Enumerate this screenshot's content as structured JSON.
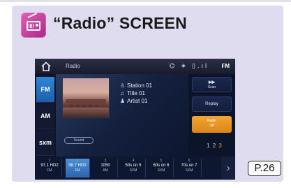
{
  "header": {
    "icon": "radio-icon",
    "title": "“Radio” SCREEN"
  },
  "screen": {
    "status_bar": {
      "home_icon": "home-icon",
      "title": "Radio",
      "icons_text": "⌬ ∗ ▯.ıl",
      "band": "FM"
    },
    "band_buttons": [
      {
        "label": "FM",
        "active": true
      },
      {
        "label": "AM",
        "active": false
      },
      {
        "label": "sxm",
        "active": false
      }
    ],
    "now_playing": {
      "station": "Station 01",
      "title": "Title 01",
      "artist": "Artist 01",
      "sound_label": "Sound"
    },
    "right_buttons": {
      "scan_label": "Scan",
      "replay_label": "Replay",
      "radio_label": "Radio",
      "radio_sub": "Off"
    },
    "preset_page": {
      "pages": [
        "1",
        "2",
        "3"
      ],
      "current_page": "3"
    },
    "presets": [
      {
        "index": "1",
        "name": "97.1 HD2",
        "band": "FM",
        "active": false
      },
      {
        "index": "2",
        "name": "98.7 HD3",
        "band": "FM",
        "active": true
      },
      {
        "index": "3",
        "name": "1050",
        "band": "AM",
        "active": false
      },
      {
        "index": "4",
        "name": "50s on 5",
        "band": "SXM",
        "active": false
      },
      {
        "index": "5",
        "name": "60s on 6",
        "band": "SXM",
        "active": false
      },
      {
        "index": "6",
        "name": "70s on 7",
        "band": "SXM",
        "active": false
      }
    ]
  },
  "page_ref": "P.26",
  "colors": {
    "panel": "#e0dcef",
    "active_blue": "#2f86d8",
    "accent_orange": "#f2a532"
  }
}
